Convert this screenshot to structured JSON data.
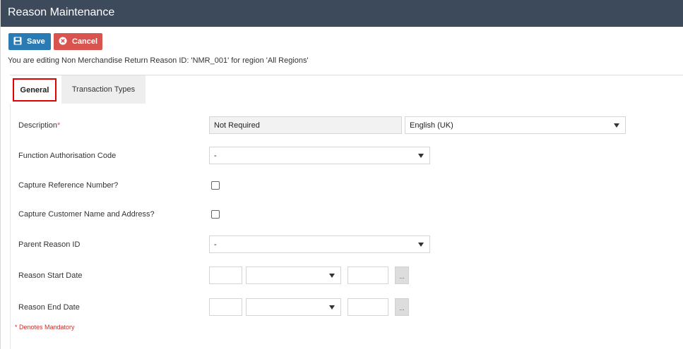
{
  "window": {
    "title": "Reason Maintenance"
  },
  "toolbar": {
    "save_label": "Save",
    "cancel_label": "Cancel"
  },
  "info_text": "You are editing Non Merchandise Return Reason ID: 'NMR_001' for region 'All Regions'",
  "tabs": [
    {
      "label": "General",
      "active": true
    },
    {
      "label": "Transaction Types",
      "active": false
    }
  ],
  "form": {
    "description": {
      "label": "Description",
      "required_mark": "*",
      "value": "Not Required",
      "language": "English (UK)"
    },
    "function_auth_code": {
      "label": "Function Authorisation Code",
      "value": "-"
    },
    "capture_reference": {
      "label": "Capture Reference Number?",
      "checked": false
    },
    "capture_customer": {
      "label": "Capture Customer Name and Address?",
      "checked": false
    },
    "parent_reason": {
      "label": "Parent Reason ID",
      "value": "-"
    },
    "start_date": {
      "label": "Reason Start Date",
      "day": "",
      "month": "",
      "year": "",
      "picker_label": "..."
    },
    "end_date": {
      "label": "Reason End Date",
      "day": "",
      "month": "",
      "year": "",
      "picker_label": "..."
    }
  },
  "mandatory_note": "* Denotes Mandatory",
  "colors": {
    "titlebar": "#3d4a5b",
    "save": "#2a7ab3",
    "cancel": "#d9534f",
    "tab_highlight": "#e00000"
  },
  "icons": {
    "save": "floppy-disk-icon",
    "cancel": "close-circle-icon",
    "dropdown": "caret-down-icon"
  }
}
